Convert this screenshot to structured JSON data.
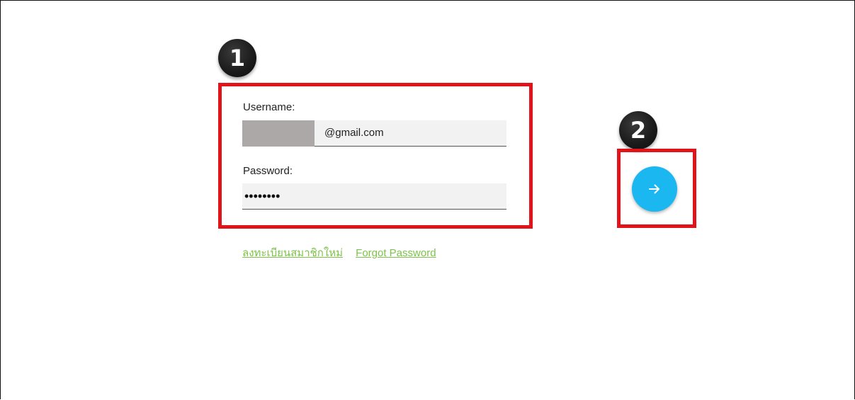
{
  "annotations": {
    "step1": "1",
    "step2": "2"
  },
  "login_form": {
    "username_label": "Username:",
    "username_value": "@gmail.com",
    "password_label": "Password:",
    "password_value": "••••••••"
  },
  "submit_button": {
    "icon": "arrow-right-icon",
    "color": "#1ab7f0"
  },
  "links": {
    "register": "ลงทะเบียนสมาชิกใหม่",
    "forgot_password": "Forgot Password"
  },
  "colors": {
    "highlight": "#e0141b",
    "link": "#7dc24a"
  }
}
